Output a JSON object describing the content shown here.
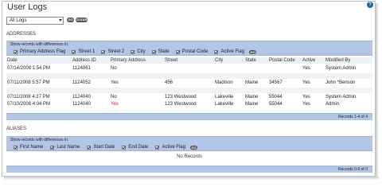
{
  "page": {
    "title": "User Logs"
  },
  "controls": {
    "logs_select": "All Logs",
    "go": "GO",
    "clear": "CLEAR"
  },
  "addresses": {
    "section": "ADDRESSES",
    "filter_label": "Show records with differences in:",
    "filters": [
      "Primary Address Flag",
      "Street 1",
      "Street 2",
      "City",
      "State",
      "Postal Code",
      "Active Flag"
    ],
    "go": "GO",
    "columns": [
      "Date",
      "Address ID",
      "Primary Address",
      "Street",
      "City",
      "State",
      "Postal Code",
      "Active",
      "Modified By"
    ],
    "rows": [
      [
        "07/14/2008 1:54 PM",
        "1124061",
        "No",
        "",
        "",
        "",
        "",
        "Yes",
        "System Admin"
      ],
      [
        "07/11/2008 5:57 PM",
        "1124052",
        "Yes",
        "456",
        "Madison",
        "Maine",
        "34567",
        "Yes",
        "John *Benson"
      ],
      [
        "07/11/2008 4:27 PM",
        "1124040",
        "No",
        "123 Westwood",
        "Lakeville",
        "Maine",
        "55044",
        "Yes",
        "System Admin"
      ],
      [
        "07/10/2008 4:04 PM",
        "1124040",
        "Yes",
        "123 Westwood",
        "Lakeville",
        "Maine",
        "55044",
        "Yes",
        "Admin"
      ]
    ],
    "footer": "Records 1-4 of 4"
  },
  "aliases": {
    "section": "ALIASES",
    "filter_label": "Show records with differences in:",
    "filters": [
      "First Name",
      "Last Name",
      "Start Date",
      "End Date",
      "Active Flag"
    ],
    "go": "GO",
    "no_records": "No Records",
    "footer": "Records 0-0 of 0"
  },
  "colors": {
    "bar": "#b3c6e7",
    "highlight": "#d11111",
    "help": "#1f5fae"
  },
  "icons": {
    "help": "help-icon",
    "dropdown": "chevron-down-icon"
  }
}
